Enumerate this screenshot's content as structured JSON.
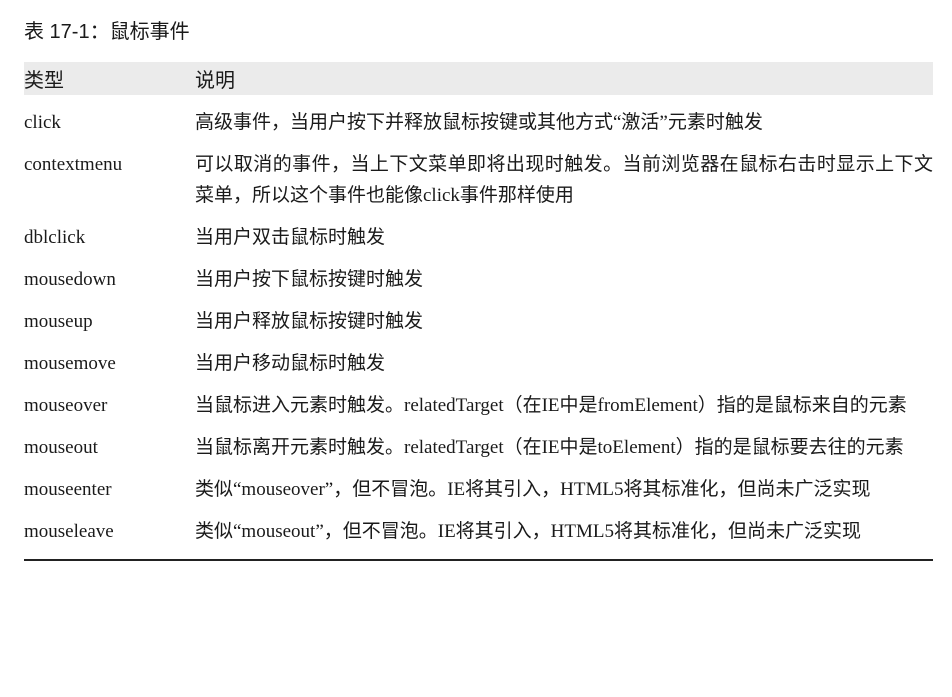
{
  "caption": "表 17-1：鼠标事件",
  "table": {
    "headers": [
      "类型",
      "说明"
    ],
    "rows": [
      {
        "type": "click",
        "desc": "高级事件，当用户按下并释放鼠标按键或其他方式“激活”元素时触发"
      },
      {
        "type": "contextmenu",
        "desc": "可以取消的事件，当上下文菜单即将出现时触发。当前浏览器在鼠标右击时显示上下文菜单，所以这个事件也能像click事件那样使用"
      },
      {
        "type": "dblclick",
        "desc": "当用户双击鼠标时触发"
      },
      {
        "type": "mousedown",
        "desc": "当用户按下鼠标按键时触发"
      },
      {
        "type": "mouseup",
        "desc": "当用户释放鼠标按键时触发"
      },
      {
        "type": "mousemove",
        "desc": "当用户移动鼠标时触发"
      },
      {
        "type": "mouseover",
        "desc": "当鼠标进入元素时触发。relatedTarget（在IE中是fromElement）指的是鼠标来自的元素"
      },
      {
        "type": "mouseout",
        "desc": "当鼠标离开元素时触发。relatedTarget（在IE中是toElement）指的是鼠标要去往的元素"
      },
      {
        "type": "mouseenter",
        "desc": "类似“mouseover”，但不冒泡。IE将其引入，HTML5将其标准化，但尚未广泛实现"
      },
      {
        "type": "mouseleave",
        "desc": "类似“mouseout”，但不冒泡。IE将其引入，HTML5将其标准化，但尚未广泛实现"
      }
    ]
  }
}
